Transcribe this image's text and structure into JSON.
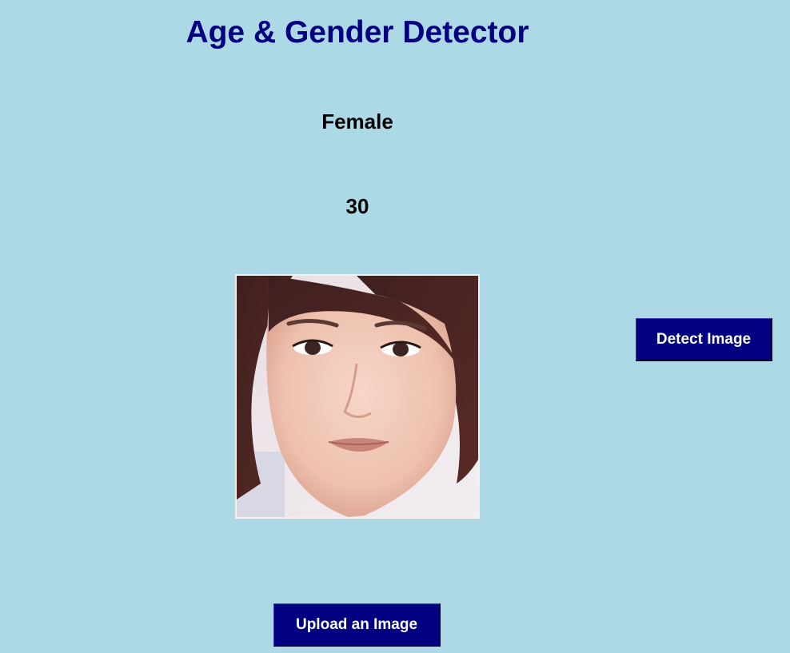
{
  "app": {
    "title": "Age & Gender Detector"
  },
  "result": {
    "gender": "Female",
    "age": "30"
  },
  "photo": {
    "alt": "Uploaded face photo"
  },
  "buttons": {
    "detect_label": "Detect Image",
    "upload_label": "Upload an Image"
  },
  "colors": {
    "background": "#add8e6",
    "accent": "#000080",
    "button_text": "#ffffff"
  }
}
